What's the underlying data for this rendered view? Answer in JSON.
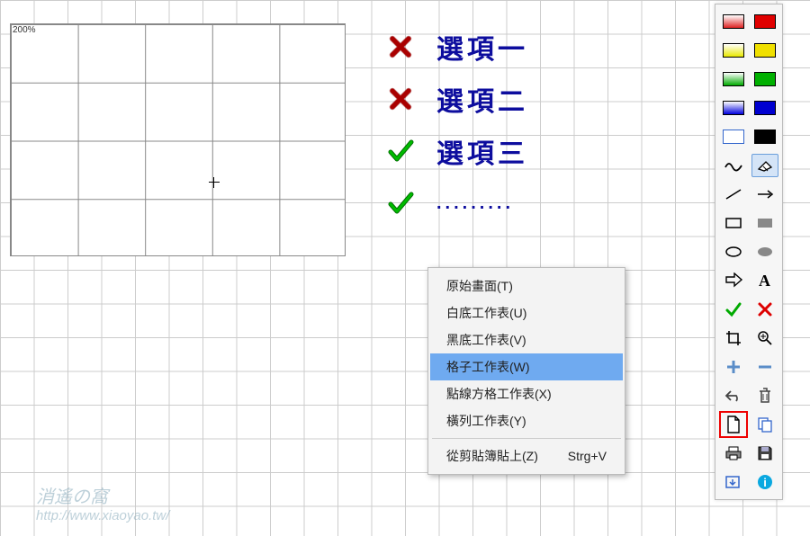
{
  "zoom": "200%",
  "options": [
    {
      "mark": "cross",
      "label": "選項一"
    },
    {
      "mark": "cross",
      "label": "選項二"
    },
    {
      "mark": "check",
      "label": "選項三"
    },
    {
      "mark": "check",
      "label": ".........",
      "dots": true
    }
  ],
  "context_menu": {
    "items": [
      {
        "label": "原始畫面(T)",
        "hover": false
      },
      {
        "label": "白底工作表(U)",
        "hover": false
      },
      {
        "label": "黑底工作表(V)",
        "hover": false
      },
      {
        "label": "格子工作表(W)",
        "hover": true
      },
      {
        "label": "點線方格工作表(X)",
        "hover": false
      },
      {
        "label": "橫列工作表(Y)",
        "hover": false
      }
    ],
    "paste": {
      "label": "從剪貼簿貼上(Z)",
      "shortcut": "Strg+V"
    }
  },
  "toolbar": {
    "swatches": [
      {
        "name": "grad-red",
        "bg": "grad-r"
      },
      {
        "name": "red",
        "bg": "#e00000"
      },
      {
        "name": "grad-yellow",
        "bg": "grad-y"
      },
      {
        "name": "yellow",
        "bg": "#f0e000"
      },
      {
        "name": "grad-green",
        "bg": "grad-g"
      },
      {
        "name": "green",
        "bg": "#00b000"
      },
      {
        "name": "grad-blue",
        "bg": "grad-b"
      },
      {
        "name": "blue",
        "bg": "#0000d0"
      },
      {
        "name": "white",
        "bg": "#ffffff"
      },
      {
        "name": "black",
        "bg": "#000000"
      }
    ],
    "rows": [
      [
        "wavy-line",
        "eraser-active"
      ],
      [
        "line",
        "arrow"
      ],
      [
        "rect-outline",
        "rect-filled"
      ],
      [
        "ellipse-outline",
        "ellipse-filled"
      ],
      [
        "arrow-big",
        "text"
      ],
      [
        "check-green",
        "cross-red"
      ],
      [
        "crop",
        "zoom-in"
      ],
      [
        "plus",
        "minus"
      ],
      [
        "undo",
        "trash"
      ],
      [
        "new-doc-selected",
        "copy"
      ],
      [
        "print",
        "save"
      ],
      [
        "export",
        "info"
      ]
    ]
  },
  "watermark": {
    "main": "消遙の窩",
    "url": "http://www.xiaoyao.tw/"
  }
}
